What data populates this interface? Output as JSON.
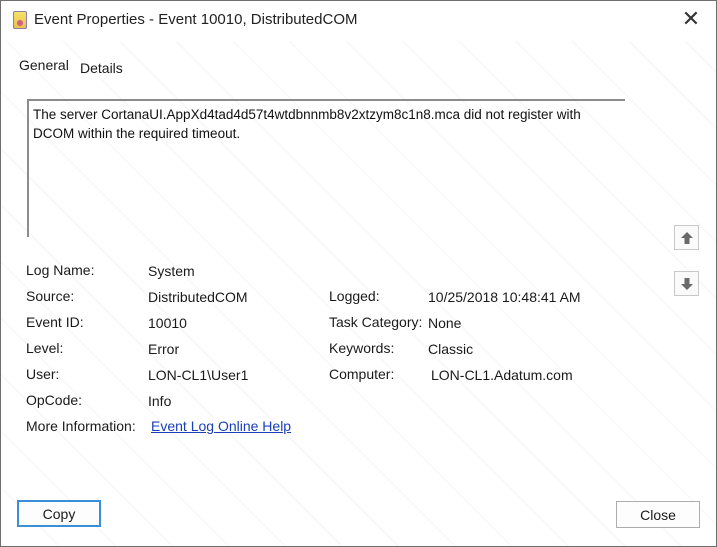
{
  "window": {
    "title": "Event Properties - Event 10010, DistributedCOM",
    "icon": "event-viewer-icon",
    "close_icon": "close-icon",
    "close_glyph": "✕"
  },
  "tabs": [
    {
      "label": "General",
      "active": true
    },
    {
      "label": "Details",
      "active": false
    }
  ],
  "description": {
    "line1": "The server  CortanaUI.AppXd4tad4d57t4wtdbnnmb8v2xtzym8c1n8.mca  did not register with",
    "line2": "DCOM within the required timeout."
  },
  "nav": {
    "up_icon": "arrow-up-icon",
    "down_icon": "arrow-down-icon"
  },
  "fields_left": [
    {
      "label": "Log Name:",
      "value": "System"
    },
    {
      "label": "Source:",
      "value": "DistributedCOM"
    },
    {
      "label": "Event ID:",
      "value": "10010"
    },
    {
      "label": "Level:",
      "value": "Error"
    },
    {
      "label": "User:",
      "value": "LON-CL1\\User1"
    },
    {
      "label": "OpCode:",
      "value": "Info"
    },
    {
      "label": "More Information:",
      "value": "Event Log Online Help"
    }
  ],
  "fields_right": [
    {
      "label": "Logged:",
      "value": "10/25/2018 10:48:41 AM"
    },
    {
      "label": "Task Category:",
      "value": "None"
    },
    {
      "label": "Keywords:",
      "value": "Classic"
    },
    {
      "label": "Computer:",
      "value": "LON-CL1.Adatum.com"
    }
  ],
  "buttons": {
    "copy": "Copy",
    "close": "Close"
  }
}
